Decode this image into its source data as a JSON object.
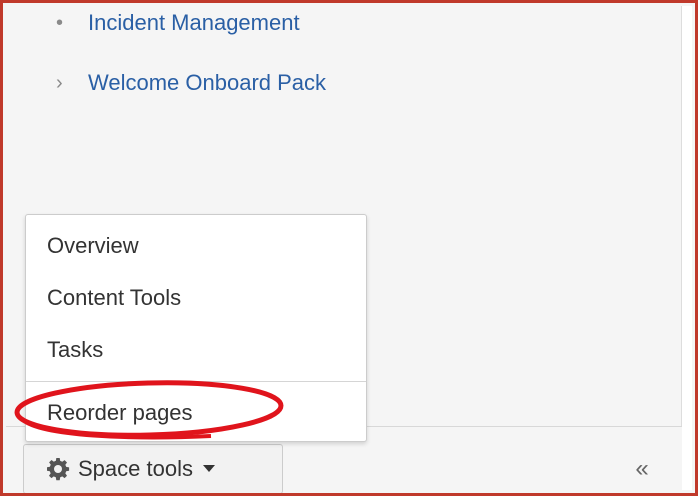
{
  "colors": {
    "link": "#2a5fa5",
    "annotation_ring": "#e0141c",
    "frame_border": "#c0392b"
  },
  "tree": {
    "items": [
      {
        "label": "Incident Management",
        "marker": "•"
      },
      {
        "label": "Welcome Onboard Pack",
        "marker": "›"
      }
    ]
  },
  "menu": {
    "items": [
      {
        "label": "Overview"
      },
      {
        "label": "Content Tools"
      },
      {
        "label": "Tasks"
      },
      {
        "label": "Reorder pages",
        "highlighted": true
      }
    ]
  },
  "footer": {
    "space_tools_label": "Space tools",
    "gear_icon": "gear-icon",
    "caret_icon": "caret-down-icon",
    "collapse_label": "«"
  }
}
